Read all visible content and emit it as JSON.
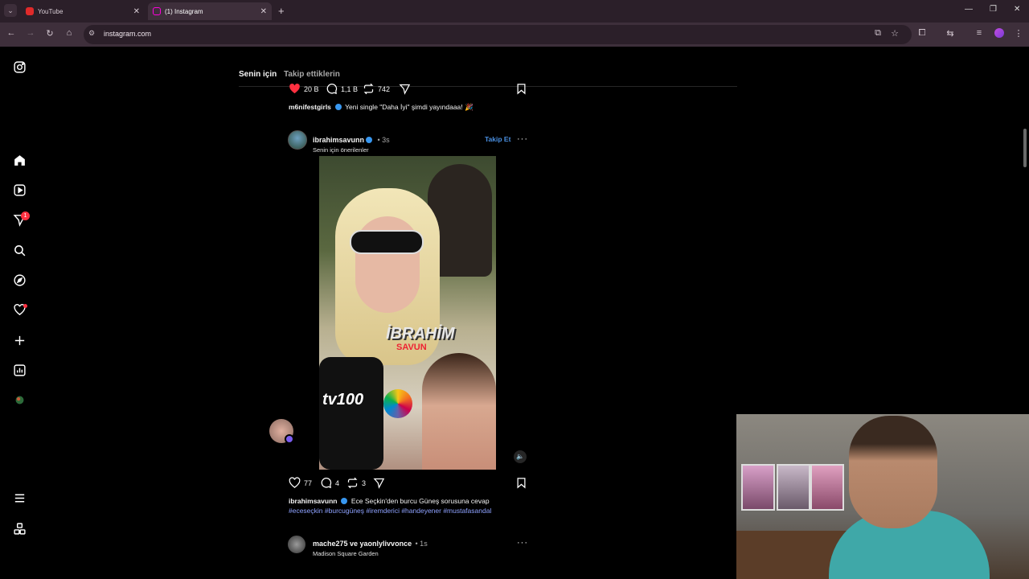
{
  "browser": {
    "tabs": [
      {
        "title": "YouTube",
        "icon": "youtube-icon"
      },
      {
        "title": "(1) Instagram",
        "icon": "instagram-icon"
      }
    ],
    "active_tab": 1,
    "url": "instagram.com"
  },
  "nav": {
    "notifications_badge": "1"
  },
  "feed": {
    "tabs": [
      "Senin için",
      "Takip ettiklerin"
    ],
    "active_tab": 0
  },
  "prev_post": {
    "likes": "20 B",
    "comments": "1,1 B",
    "reposts": "742",
    "username": "m6nifestgirls",
    "caption": "Yeni single \"Daha İyi\" şimdi yayındaaa! 🎉"
  },
  "post": {
    "username": "ibrahimsavunn",
    "time": "• 3s",
    "subtitle": "Senin için önerilenler",
    "follow_label": "Takip Et",
    "video_overlay_name": "İBRAHİM",
    "video_overlay_sub": "SAVUN",
    "video_mic_brand": "tv100",
    "likes": "77",
    "comments": "4",
    "reposts": "3",
    "caption_user": "ibrahimsavunn",
    "caption": "Ece Seçkin'den burcu Güneş sorusuna cevap",
    "hashtags": "#eceseçkin #burcugüneş #iremderici #handeyener #mustafasandal"
  },
  "next_post": {
    "username": "mache275 ve yaonlylivvonce",
    "time": "• 1s",
    "subtitle": "Madison Square Garden"
  }
}
